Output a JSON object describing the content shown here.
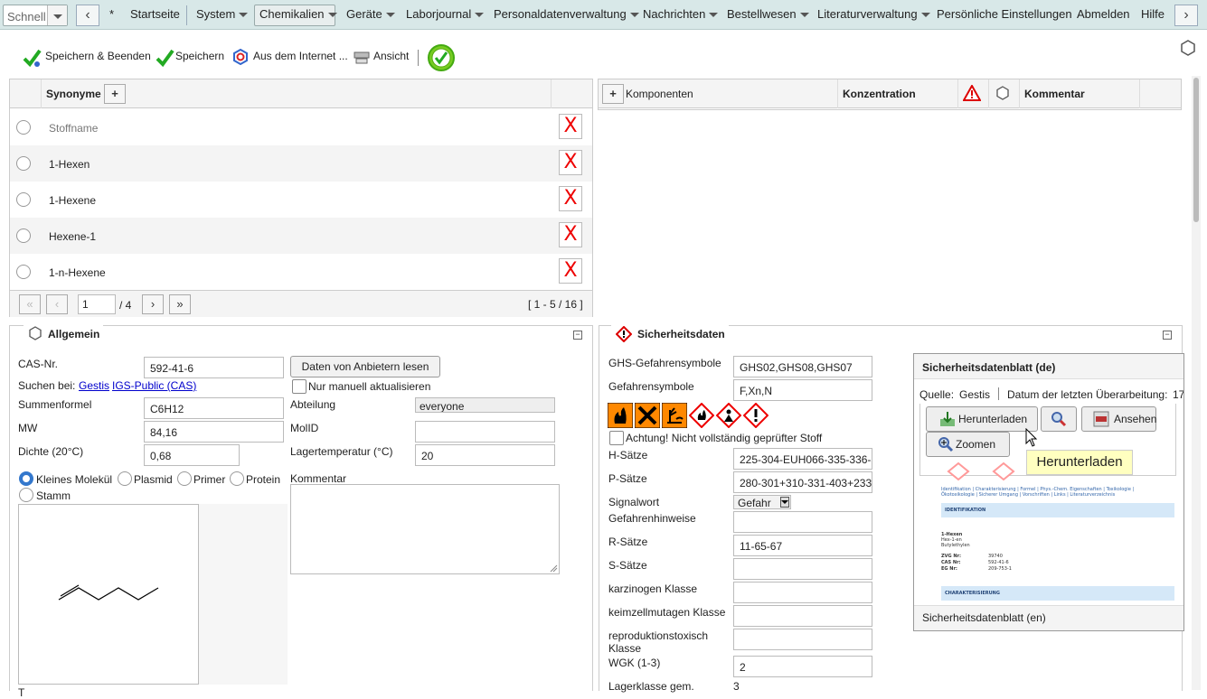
{
  "topbar": {
    "quick_label": "Schnell",
    "star": "*",
    "menus": [
      {
        "label": "Startseite",
        "dropdown": false
      },
      {
        "label": "System",
        "dropdown": true
      },
      {
        "label": "Chemikalien",
        "dropdown": true,
        "active": true
      },
      {
        "label": "Geräte",
        "dropdown": true
      },
      {
        "label": "Laborjournal",
        "dropdown": true
      },
      {
        "label": "Personaldatenverwaltung",
        "dropdown": true
      },
      {
        "label": "Nachrichten",
        "dropdown": true
      },
      {
        "label": "Bestellwesen",
        "dropdown": true
      },
      {
        "label": "Literaturverwaltung",
        "dropdown": true
      },
      {
        "label": "Persönliche Einstellungen",
        "dropdown": false
      },
      {
        "label": "Abmelden",
        "dropdown": false
      },
      {
        "label": "Hilfe",
        "dropdown": false
      }
    ]
  },
  "toolbar": {
    "save_close": "Speichern & Beenden",
    "save": "Speichern",
    "from_internet": "Aus dem Internet ...",
    "view": "Ansicht"
  },
  "synonyms": {
    "header": "Synonyme",
    "add": "+",
    "rows": [
      "Stoffname",
      "1-Hexen",
      "1-Hexene",
      "Hexene-1",
      "1-n-Hexene"
    ],
    "delete_label": "X",
    "pager": {
      "page": "1",
      "of": "/ 4",
      "range": "[ 1 - 5 / 16 ]"
    }
  },
  "components": {
    "add": "+",
    "col_components": "Komponenten",
    "col_concentration": "Konzentration",
    "col_comment": "Kommentar"
  },
  "allgemein": {
    "title": "Allgemein",
    "cas_label": "CAS-Nr.",
    "cas_value": "592-41-6",
    "fetch_button": "Daten von Anbietern lesen",
    "search_at": "Suchen bei:",
    "link_gestis": "Gestis",
    "link_igs": "IGS-Public (CAS)",
    "manual_update": "Nur manuell aktualisieren",
    "formula_label": "Summenformel",
    "formula_value": "C6H12",
    "department_label": "Abteilung",
    "department_value": "everyone",
    "mw_label": "MW",
    "mw_value": "84,16",
    "molid_label": "MolID",
    "molid_value": "",
    "density_label": "Dichte (20°C)",
    "density_value": "0,68",
    "storage_temp_label": "Lagertemperatur (°C)",
    "storage_temp_value": "20",
    "types": [
      "Kleines Molekül",
      "Plasmid",
      "Primer",
      "Protein",
      "Stamm"
    ],
    "comment_label": "Kommentar",
    "bottom_cut": "T"
  },
  "safety": {
    "title": "Sicherheitsdaten",
    "ghs_symbols_label": "GHS-Gefahrensymbole",
    "ghs_symbols_value": "GHS02,GHS08,GHS07",
    "hazard_symbols_label": "Gefahrensymbole",
    "hazard_symbols_value": "F,Xn,N",
    "caution_text": "Achtung! Nicht vollständig geprüfter Stoff",
    "h_label": "H-Sätze",
    "h_value": "225-304-EUH066-335-336-3",
    "p_label": "P-Sätze",
    "p_value": "280-301+310-331-403+233-",
    "signal_label": "Signalwort",
    "signal_value": "Gefahr",
    "hazard_notes_label": "Gefahrenhinweise",
    "r_label": "R-Sätze",
    "r_value": "11-65-67",
    "s_label": "S-Sätze",
    "carc_label": "karzinogen Klasse",
    "muta_label": "keimzellmutagen Klasse",
    "repro_label": "reproduktionstoxisch Klasse",
    "wgk_label": "WGK (1-3)",
    "wgk_value": "2",
    "storage_class_label": "Lagerklasse gem.",
    "storage_class_value": "3"
  },
  "sds": {
    "title": "Sicherheitsdatenblatt (de)",
    "source_label": "Quelle:",
    "source_value": "Gestis",
    "revision_label": "Datum der letzten Überarbeitung:",
    "revision_value": "17",
    "download": "Herunterladen",
    "view": "Ansehen",
    "zoom": "Zoomen",
    "tooltip": "Herunterladen",
    "footer": "Sicherheitsdatenblatt (en)",
    "doc_nav": "Identifikation | Charakterisierung | Formel | Phys.-Chem. Eigenschaften | Toxikologie | Ökotoxikologie | Sicherer Umgang | Vorschriften | Links | Literaturverzeichnis",
    "doc_section1": "IDENTIFIKATION",
    "doc_name": "1-Hexen",
    "doc_syn1": "Hex-1-en",
    "doc_syn2": "Butylethylen",
    "doc_zvg_label": "ZVG Nr:",
    "doc_zvg": "39740",
    "doc_cas_label": "CAS Nr:",
    "doc_cas": "592-41-6",
    "doc_eg_label": "EG Nr:",
    "doc_eg": "209-753-1",
    "doc_section2": "CHARAKTERISIERUNG"
  },
  "colors": {
    "topbar": "#d8e8e8",
    "ghs_red": "#e00000",
    "orange": "#ff8c00",
    "link": "#0000cc"
  }
}
